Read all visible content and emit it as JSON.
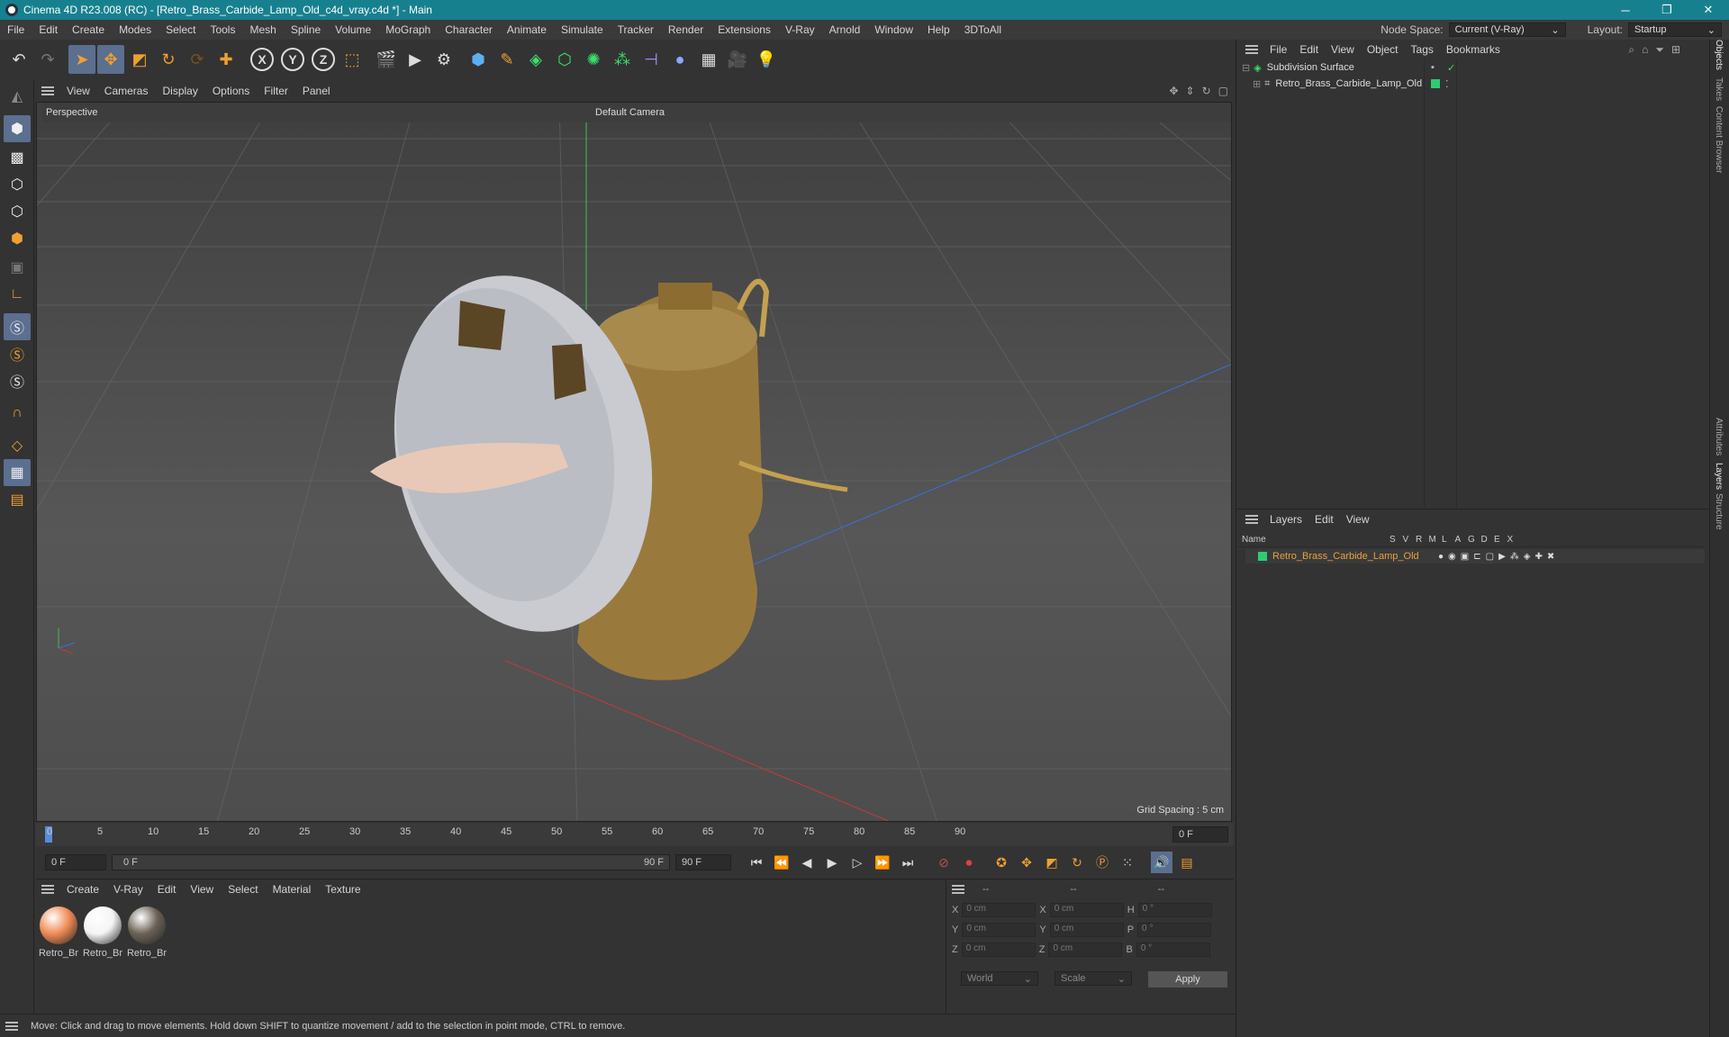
{
  "window": {
    "title": "Cinema 4D R23.008 (RC) - [Retro_Brass_Carbide_Lamp_Old_c4d_vray.c4d *] - Main",
    "minimize": "─",
    "maximize": "❐",
    "close": "✕"
  },
  "menubar": {
    "items": [
      "File",
      "Edit",
      "Create",
      "Modes",
      "Select",
      "Tools",
      "Mesh",
      "Spline",
      "Volume",
      "MoGraph",
      "Character",
      "Animate",
      "Simulate",
      "Tracker",
      "Render",
      "Extensions",
      "V-Ray",
      "Arnold",
      "Window",
      "Help",
      "3DToAll"
    ],
    "node_space_label": "Node Space:",
    "node_space_value": "Current (V-Ray)",
    "layout_label": "Layout:",
    "layout_value": "Startup"
  },
  "viewport": {
    "menu": [
      "View",
      "Cameras",
      "Display",
      "Options",
      "Filter",
      "Panel"
    ],
    "name": "Perspective",
    "camera": "Default Camera",
    "grid_spacing": "Grid Spacing : 5 cm"
  },
  "timeline": {
    "ticks": [
      "0",
      "5",
      "10",
      "15",
      "20",
      "25",
      "30",
      "35",
      "40",
      "45",
      "50",
      "55",
      "60",
      "65",
      "70",
      "75",
      "80",
      "85",
      "90"
    ],
    "current_frame": "0 F",
    "start_field": "0 F",
    "range_start": "0 F",
    "range_end": "90 F",
    "end_field": "90 F"
  },
  "material_manager": {
    "menu": [
      "Create",
      "V-Ray",
      "Edit",
      "View",
      "Select",
      "Material",
      "Texture"
    ],
    "materials": [
      {
        "name": "Retro_Br",
        "color": "#f08b55"
      },
      {
        "name": "Retro_Br",
        "color": "#f4f4f4"
      },
      {
        "name": "Retro_Br",
        "color": "#6b6256"
      }
    ]
  },
  "coordinates": {
    "header": [
      "--",
      "--",
      "--"
    ],
    "rows": [
      {
        "a": "X",
        "av": "0 cm",
        "b": "X",
        "bv": "0 cm",
        "c": "H",
        "cv": "0 °"
      },
      {
        "a": "Y",
        "av": "0 cm",
        "b": "Y",
        "bv": "0 cm",
        "c": "P",
        "cv": "0 °"
      },
      {
        "a": "Z",
        "av": "0 cm",
        "b": "Z",
        "bv": "0 cm",
        "c": "B",
        "cv": "0 °"
      }
    ],
    "space": "World",
    "mode": "Scale",
    "apply": "Apply"
  },
  "status": {
    "text": "Move: Click and drag to move elements. Hold down SHIFT to quantize movement / add to the selection in point mode, CTRL to remove."
  },
  "object_manager": {
    "menu": [
      "File",
      "Edit",
      "View",
      "Object",
      "Tags",
      "Bookmarks"
    ],
    "objects": [
      {
        "name": "Subdivision Surface"
      },
      {
        "name": "Retro_Brass_Carbide_Lamp_Old"
      }
    ]
  },
  "layers": {
    "menu": [
      "Layers",
      "Edit",
      "View"
    ],
    "columns": [
      "Name",
      "S",
      "V",
      "R",
      "M",
      "L",
      "A",
      "G",
      "D",
      "E",
      "X"
    ],
    "items": [
      {
        "name": "Retro_Brass_Carbide_Lamp_Old",
        "color": "#2ecc71"
      }
    ]
  },
  "side_tabs": [
    "Objects",
    "Takes",
    "Content Browser",
    "Attributes",
    "Layers",
    "Structure"
  ],
  "colors": {
    "titlebar": "#17808f",
    "active_tool": "#5b6f8f",
    "layer_name": "#e8a13c"
  }
}
